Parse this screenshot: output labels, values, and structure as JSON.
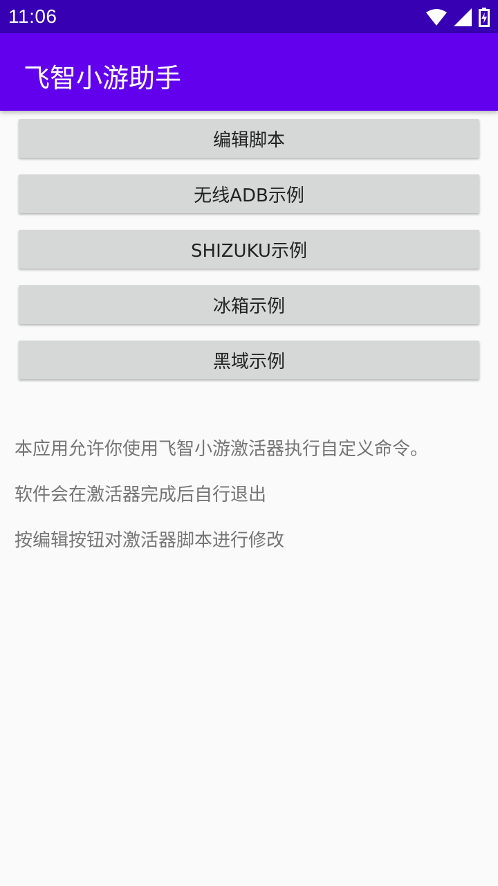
{
  "status_bar": {
    "time": "11:06",
    "icons": [
      "wifi-icon",
      "signal-icon",
      "battery-icon"
    ]
  },
  "app_bar": {
    "title": "飞智小游助手"
  },
  "buttons": [
    "编辑脚本",
    "无线ADB示例",
    "SHIZUKU示例",
    "冰箱示例",
    "黑域示例"
  ],
  "info": [
    "本应用允许你使用飞智小游激活器执行自定义命令。",
    "软件会在激活器完成后自行退出",
    "按编辑按钮对激活器脚本进行修改"
  ],
  "colors": {
    "status_bar": "#3700b3",
    "app_bar": "#6200ee",
    "button_bg": "#d6d7d7",
    "background": "#fafafa"
  }
}
